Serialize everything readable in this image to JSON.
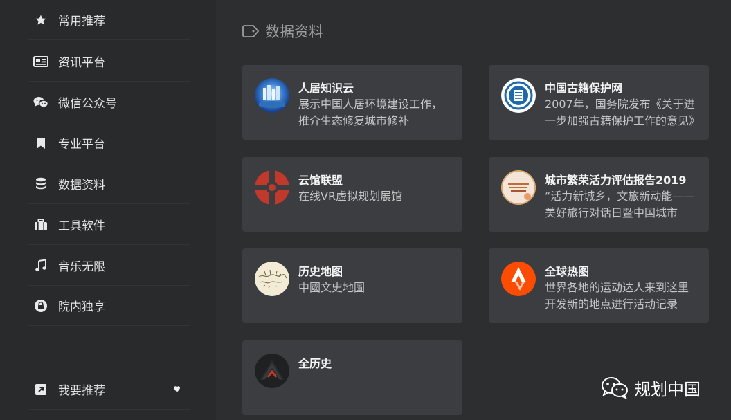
{
  "sidebar": {
    "items": [
      {
        "label": "常用推荐",
        "icon": "star-icon"
      },
      {
        "label": "资讯平台",
        "icon": "newspaper-icon"
      },
      {
        "label": "微信公众号",
        "icon": "wechat-icon"
      },
      {
        "label": "专业平台",
        "icon": "bookmark-icon"
      },
      {
        "label": "数据资料",
        "icon": "database-icon"
      },
      {
        "label": "工具软件",
        "icon": "briefcase-icon"
      },
      {
        "label": "音乐无限",
        "icon": "music-icon"
      },
      {
        "label": "院内独享",
        "icon": "lock-icon"
      }
    ],
    "recommend": {
      "label": "我要推荐",
      "icon": "share-icon",
      "badge": "♥"
    }
  },
  "section": {
    "title": "数据资料",
    "icon": "tag-icon"
  },
  "cards": [
    {
      "title": "人居知识云",
      "desc": "展示中国人居环境建设工作，推介生态修复城市修补",
      "avatar": "globe-logo"
    },
    {
      "title": "中国古籍保护网",
      "desc": "2007年，国务院发布《关于进一步加强古籍保护工作的意见》",
      "avatar": "ancient-books-logo"
    },
    {
      "title": "云馆联盟",
      "desc": "在线VR虚拟规划展馆",
      "avatar": "cloud-hall-logo"
    },
    {
      "title": "城市繁荣活力评估报告2019",
      "desc": "“活力新城乡，文旅新动能——美好旅行对话日暨中国城市",
      "avatar": "report-cover-logo"
    },
    {
      "title": "历史地图",
      "desc": "中國文史地圖",
      "avatar": "historical-map-logo"
    },
    {
      "title": "全球热图",
      "desc": "世界各地的运动达人来到这里开发新的地点进行活动记录",
      "avatar": "strava-logo"
    },
    {
      "title": "全历史",
      "desc": "",
      "avatar": "all-history-logo"
    }
  ],
  "watermark": {
    "text": "规划中国",
    "icon": "wechat-icon"
  }
}
